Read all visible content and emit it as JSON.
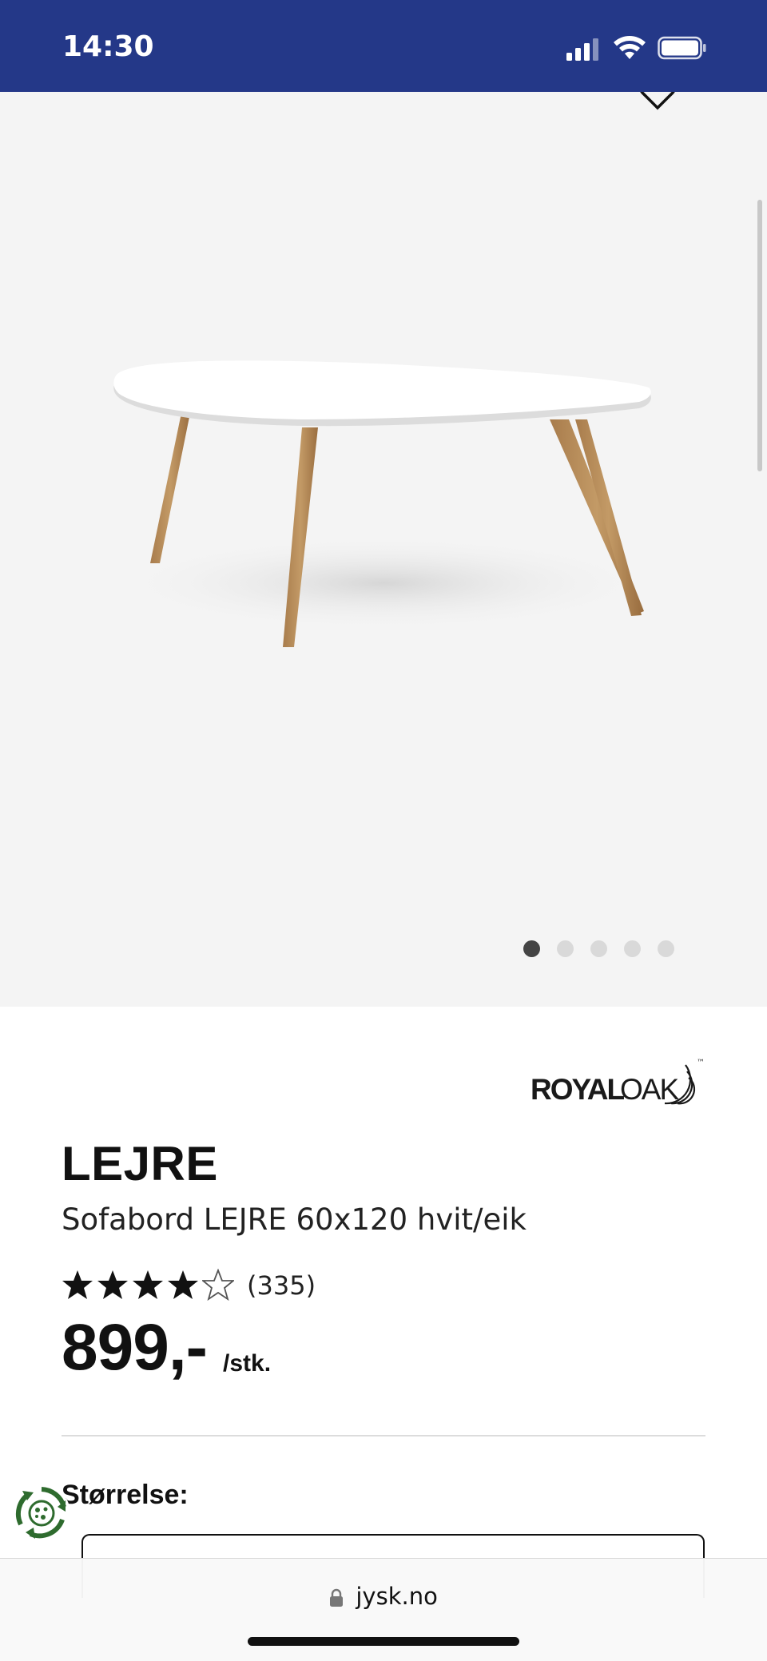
{
  "status_bar": {
    "time": "14:30",
    "icons": [
      "cellular-signal-icon",
      "wifi-icon",
      "battery-icon"
    ],
    "background": "#243888"
  },
  "gallery": {
    "image_alt": "Sofabord LEJRE 60x120 hvit/eik",
    "slide_count": 5,
    "active_slide": 1,
    "favorite_icon": "heart-outline-icon"
  },
  "product": {
    "brand": "ROYALOAK",
    "brand_parts": [
      "ROYAL",
      "OAK"
    ],
    "brand_tm": "™",
    "name": "LEJRE",
    "description": "Sofabord LEJRE 60x120 hvit/eik",
    "rating": {
      "stars": 4,
      "max": 5,
      "count_text": "(335)"
    },
    "price": "899,-",
    "price_unit": "/stk."
  },
  "options": {
    "size_label": "Størrelse:"
  },
  "browser": {
    "url": "jysk.no"
  },
  "colors": {
    "brand_blue": "#243888",
    "eco_green": "#2e6b2e"
  }
}
